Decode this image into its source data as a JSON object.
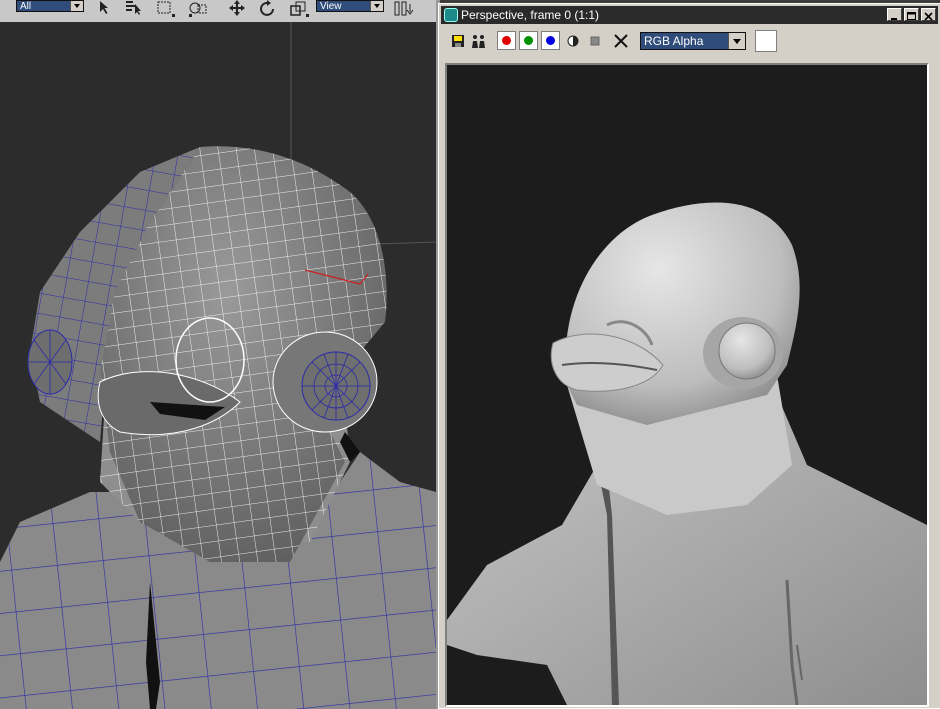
{
  "main_toolbar": {
    "filter_selection": "All",
    "reference_coordinate": "View"
  },
  "frame_window": {
    "title": "Perspective, frame 0 (1:1)",
    "channel_select": "RGB Alpha",
    "colors": {
      "red": "#e00000",
      "green": "#009000",
      "blue": "#0000e0"
    }
  },
  "icons": [
    "select-icon",
    "select-by-name-icon",
    "rect-region-icon",
    "window-crossing-icon",
    "move-icon",
    "rotate-icon",
    "scale-icon",
    "pivot-icon",
    "save-image-icon",
    "clone-frame-icon",
    "mono-channel-icon",
    "clear-icon",
    "close-x-icon"
  ]
}
